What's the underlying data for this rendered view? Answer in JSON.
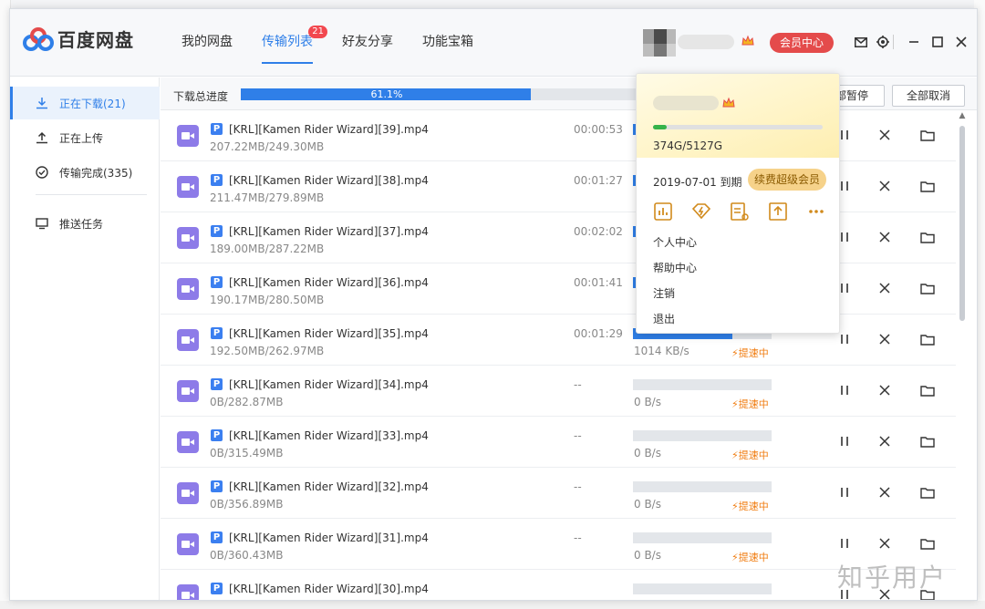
{
  "app": {
    "name": "百度网盘"
  },
  "nav": {
    "tabs": [
      {
        "label": "我的网盘"
      },
      {
        "label": "传输列表",
        "badge": "21"
      },
      {
        "label": "好友分享"
      },
      {
        "label": "功能宝箱"
      }
    ]
  },
  "header": {
    "vip_label": "会员中心"
  },
  "sidebar": {
    "items": [
      {
        "label": "正在下载(21)"
      },
      {
        "label": "正在上传"
      },
      {
        "label": "传输完成(335)"
      },
      {
        "label": "推送任务"
      }
    ]
  },
  "toolbar": {
    "total_label": "下载总进度",
    "total_percent": "61.1%",
    "total_fraction": 0.611,
    "pause_all_label": "部暂停",
    "cancel_all_label": "全部取消"
  },
  "downloads": [
    {
      "name": "[KRL][Kamen Rider Wizard][39].mp4",
      "size": "207.22MB/249.30MB",
      "time": "00:00:53",
      "progress": 0.83,
      "speed": "",
      "boost": ""
    },
    {
      "name": "[KRL][Kamen Rider Wizard][38].mp4",
      "size": "211.47MB/279.89MB",
      "time": "00:01:27",
      "progress": 0.76,
      "speed": "",
      "boost": ""
    },
    {
      "name": "[KRL][Kamen Rider Wizard][37].mp4",
      "size": "189.00MB/287.22MB",
      "time": "00:02:02",
      "progress": 0.66,
      "speed": "",
      "boost": ""
    },
    {
      "name": "[KRL][Kamen Rider Wizard][36].mp4",
      "size": "190.17MB/280.50MB",
      "time": "00:01:41",
      "progress": 0.68,
      "speed": "",
      "boost": ""
    },
    {
      "name": "[KRL][Kamen Rider Wizard][35].mp4",
      "size": "192.50MB/262.97MB",
      "time": "00:01:29",
      "progress": 0.72,
      "speed": "1014 KB/s",
      "boost": "提速中"
    },
    {
      "name": "[KRL][Kamen Rider Wizard][34].mp4",
      "size": "0B/282.87MB",
      "time": "--",
      "progress": 0,
      "speed": "0 B/s",
      "boost": "提速中"
    },
    {
      "name": "[KRL][Kamen Rider Wizard][33].mp4",
      "size": "0B/315.49MB",
      "time": "--",
      "progress": 0,
      "speed": "0 B/s",
      "boost": "提速中"
    },
    {
      "name": "[KRL][Kamen Rider Wizard][32].mp4",
      "size": "0B/356.89MB",
      "time": "--",
      "progress": 0,
      "speed": "0 B/s",
      "boost": "提速中"
    },
    {
      "name": "[KRL][Kamen Rider Wizard][31].mp4",
      "size": "0B/360.43MB",
      "time": "--",
      "progress": 0,
      "speed": "0 B/s",
      "boost": "提速中"
    },
    {
      "name": "[KRL][Kamen Rider Wizard][30].mp4",
      "size": "",
      "time": "",
      "progress": 0,
      "speed": "",
      "boost": ""
    }
  ],
  "popup": {
    "quota_text": "374G/5127G",
    "quota_fraction": 0.073,
    "expire_text": "2019-07-01 到期",
    "renew_label": "续费超级会员",
    "icons": [
      "chart-icon",
      "speed-icon",
      "list-icon",
      "upload-icon",
      "more-icon"
    ],
    "menu": [
      {
        "label": "个人中心"
      },
      {
        "label": "帮助中心"
      },
      {
        "label": "注销"
      },
      {
        "label": "退出"
      }
    ]
  },
  "watermark": "知乎用户",
  "colors": {
    "accent": "#2f7fe8",
    "vip_red": "#e44b4b",
    "boost_orange": "#f07c10",
    "video_purple": "#8d7be8",
    "quota_green": "#35b34a"
  }
}
